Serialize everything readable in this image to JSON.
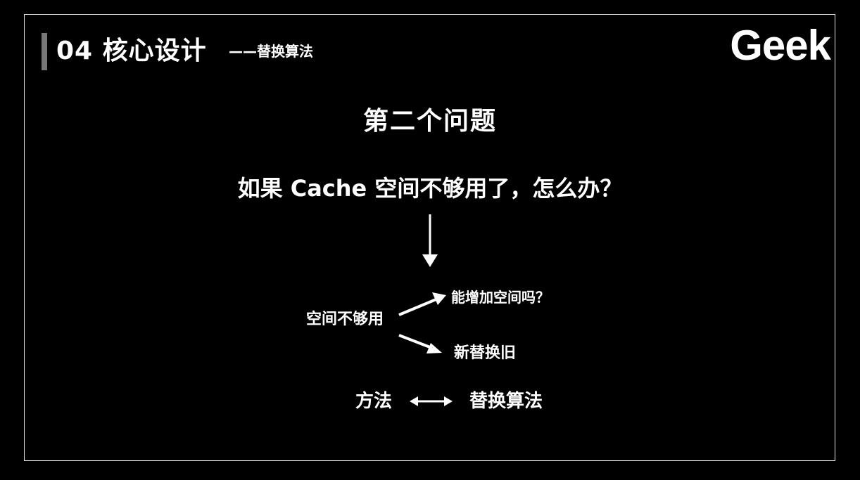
{
  "header": {
    "title": "04 核心设计",
    "subtitle": "——替换算法",
    "logo": "Geek"
  },
  "content": {
    "heading": "第二个问题",
    "question": "如果 Cache 空间不够用了，怎么办？",
    "flow": {
      "source": "空间不够用",
      "option_1": "能增加空间吗？",
      "option_2": "新替换旧"
    },
    "method": {
      "left": "方法",
      "right": "替换算法"
    }
  }
}
